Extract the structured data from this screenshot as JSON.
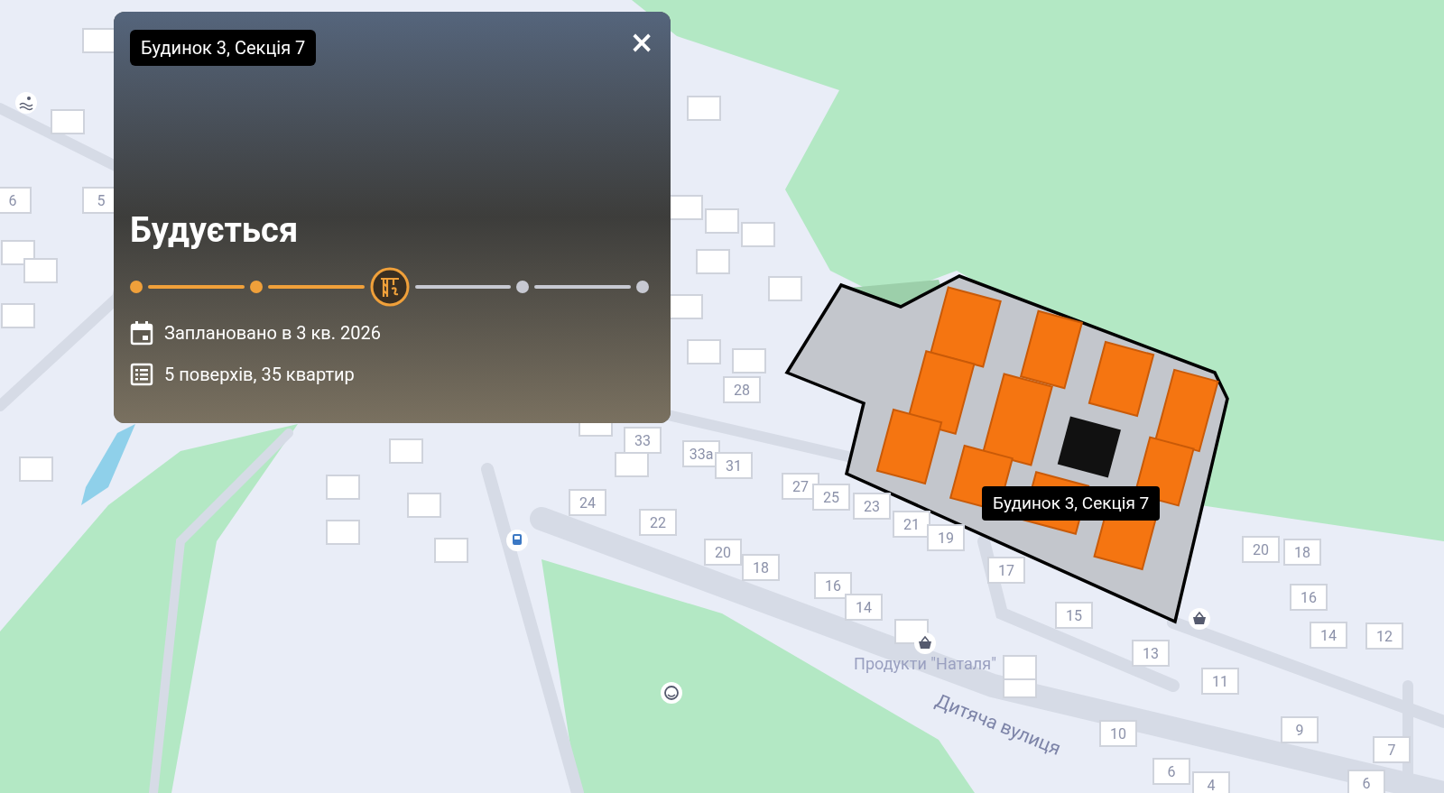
{
  "card": {
    "badge": "Будинок 3, Секція 7",
    "close": "×",
    "status_title": "Будується",
    "stages": [
      {
        "completed": true
      },
      {
        "completed": true
      },
      {
        "completed": false
      },
      {
        "completed": false
      },
      {
        "completed": false
      }
    ],
    "planned": "Заплановано в 3 кв. 2026",
    "floors": "5 поверхів, 35 квартир"
  },
  "map": {
    "tooltip": "Будинок 3, Секція 7",
    "poi_label": "Продукти \"Наталя\"",
    "street_label": "Дитяча вулиця",
    "house_numbers": [
      "33а",
      "31",
      "27",
      "25",
      "23",
      "24",
      "22",
      "21",
      "19",
      "20",
      "18",
      "16",
      "14",
      "17",
      "15",
      "13",
      "11",
      "10",
      "9",
      "7",
      "6",
      "4",
      "6",
      "20",
      "18",
      "16",
      "14",
      "12",
      "28",
      "33",
      "6",
      "5"
    ]
  }
}
